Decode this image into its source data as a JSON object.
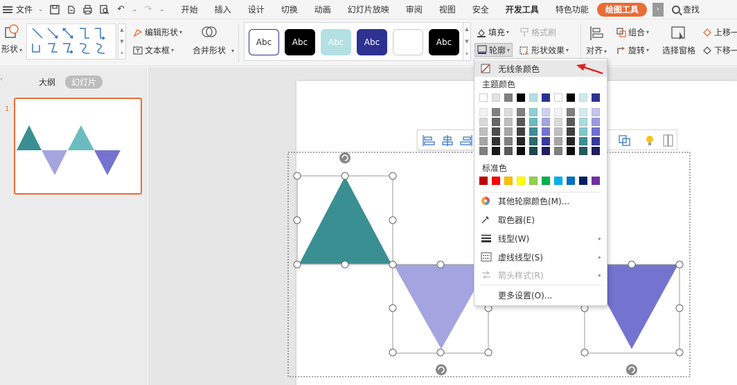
{
  "menubar": {
    "file": "文件",
    "tabs": [
      "开始",
      "插入",
      "设计",
      "切换",
      "动画",
      "幻灯片放映",
      "审阅",
      "视图",
      "安全",
      "开发工具",
      "特色功能"
    ],
    "active_tab": "绘图工具",
    "search": "查找"
  },
  "ribbon": {
    "shape_btn": "形状",
    "edit_shape": "编辑形状",
    "text_box": "文本框",
    "merge_shape": "合并形状",
    "style_abc": "Abc",
    "fill": "填充",
    "format_brush": "格式刷",
    "outline": "轮廓",
    "shape_effect": "形状效果",
    "align": "对齐",
    "group": "组合",
    "rotate": "旋转",
    "select_pane": "选择窗格",
    "move_up": "上移一",
    "move_down": "下移一"
  },
  "leftpanel": {
    "outline_tab": "大纲",
    "slides_tab": "幻灯片",
    "slide_number": "1"
  },
  "dropdown": {
    "no_line_color": "无线条颜色",
    "theme_colors": "主题颜色",
    "standard_colors": "标准色",
    "more_outline_colors": "其他轮廓颜色(M)...",
    "eyedropper": "取色器(E)",
    "line_type": "线型(W)",
    "dash_type": "虚线线型(S)",
    "arrow_style": "箭头样式(R)",
    "more_settings": "更多设置(O)..."
  },
  "colors": {
    "accent": "#e96c35",
    "teal": "#3a8f93",
    "light_teal": "#6bbcc0",
    "lavender": "#a4a4e0",
    "purple": "#7474d0",
    "navy": "#2e3192"
  }
}
